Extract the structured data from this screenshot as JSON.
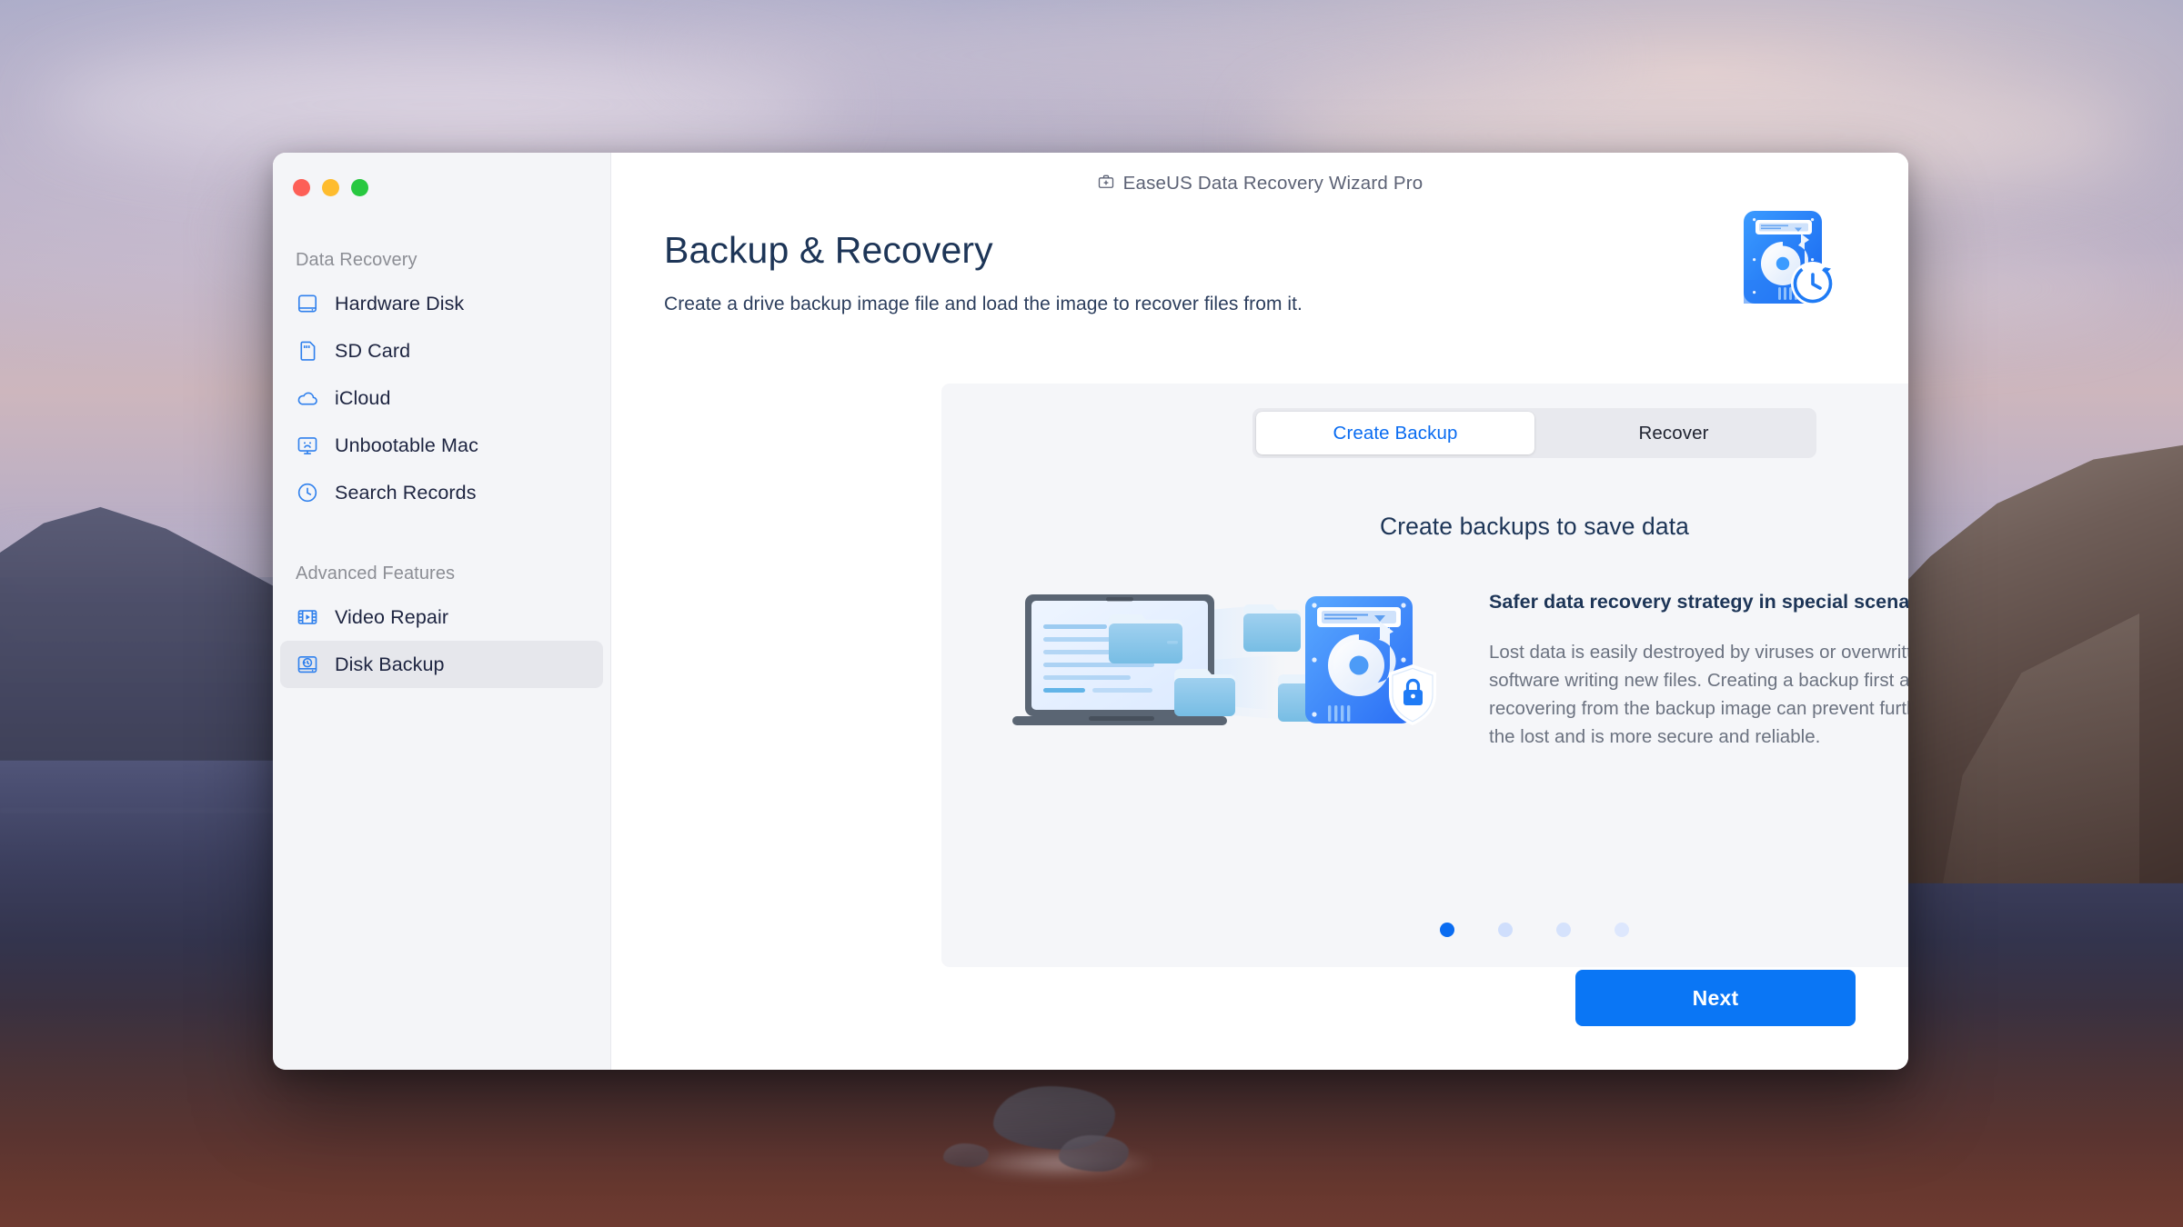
{
  "window": {
    "titlebar": {
      "app_name": "EaseUS Data Recovery Wizard  Pro",
      "icon": "toolbox-plus-icon"
    },
    "traffic_lights": {
      "close": "close",
      "minimize": "minimize",
      "zoom": "zoom"
    }
  },
  "sidebar": {
    "groups": [
      {
        "title": "Data Recovery",
        "items": [
          {
            "label": "Hardware Disk",
            "icon": "hard-disk-icon",
            "active": false
          },
          {
            "label": "SD Card",
            "icon": "sd-card-icon",
            "active": false
          },
          {
            "label": "iCloud",
            "icon": "cloud-icon",
            "active": false
          },
          {
            "label": "Unbootable Mac",
            "icon": "sad-monitor-icon",
            "active": false
          },
          {
            "label": "Search Records",
            "icon": "clock-icon",
            "active": false
          }
        ]
      },
      {
        "title": "Advanced Features",
        "items": [
          {
            "label": "Video Repair",
            "icon": "film-play-icon",
            "active": false
          },
          {
            "label": "Disk Backup",
            "icon": "disk-backup-icon",
            "active": true
          }
        ]
      }
    ]
  },
  "page": {
    "title": "Backup & Recovery",
    "subtitle": "Create a drive backup image file and load the image to recover files from it.",
    "hero_icon": "hard-drive-history-icon"
  },
  "card": {
    "tabs": [
      {
        "label": "Create Backup",
        "active": true
      },
      {
        "label": "Recover",
        "active": false
      }
    ],
    "heading": "Create backups to save data",
    "illustration": "laptop-folders-to-disk-illustration",
    "feature": {
      "title": "Safer data recovery strategy in special scenarios",
      "body": "Lost data is easily destroyed by viruses or overwritten by other software writing new files. Creating a backup first and then recovering from the backup image can prevent further damage to the lost and is more secure and reliable."
    },
    "carousel": {
      "total": 4,
      "current": 1
    }
  },
  "footer": {
    "next_label": "Next"
  },
  "colors": {
    "accent_blue": "#0a6cf1",
    "button_blue": "#0a76f5",
    "icon_blue": "#2f80ed",
    "heading_navy": "#1d3557",
    "sidebar_bg": "#f4f5f8",
    "card_bg": "#f5f6f9",
    "muted_text": "#8c8e95",
    "body_text": "#6b7280",
    "traffic_red": "#fd5f57",
    "traffic_yellow": "#febc2e",
    "traffic_green": "#28c840"
  }
}
